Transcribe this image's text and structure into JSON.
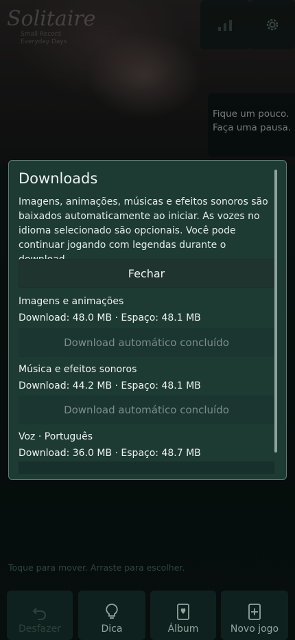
{
  "header": {
    "logo_title": "Solitaire",
    "logo_sub1": "Small Record",
    "logo_sub2": "Everyday Days",
    "stats_icon": "bar-chart-icon",
    "settings_icon": "gear-icon",
    "quote_line1": "Fique um pouco.",
    "quote_line2": "Faça uma pausa."
  },
  "modal": {
    "title": "Downloads",
    "description": "Imagens, animações, músicas e efeitos sonoros são baixados automaticamente ao iniciar. As vozes no idioma selecionado são opcionais. Você pode continuar jogando com legendas durante o download.",
    "close_label": "Fechar",
    "sections": [
      {
        "title": "Imagens e animações",
        "stats": "Download: 48.0 MB · Espaço: 48.1 MB",
        "status": "Download automático concluído"
      },
      {
        "title": "Música e efeitos sonoros",
        "stats": "Download: 44.2 MB · Espaço: 48.1 MB",
        "status": "Download automático concluído"
      },
      {
        "title": "Voz · Português",
        "stats": "Download: 36.0 MB · Espaço: 48.7 MB"
      }
    ]
  },
  "footer": {
    "hint": "Toque para mover. Arraste para escolher.",
    "buttons": [
      {
        "label": "Desfazer",
        "icon": "undo-icon",
        "enabled": false
      },
      {
        "label": "Dica",
        "icon": "lightbulb-icon",
        "enabled": true
      },
      {
        "label": "Álbum",
        "icon": "album-card-icon",
        "enabled": true
      },
      {
        "label": "Novo jogo",
        "icon": "new-game-icon",
        "enabled": true
      }
    ]
  }
}
